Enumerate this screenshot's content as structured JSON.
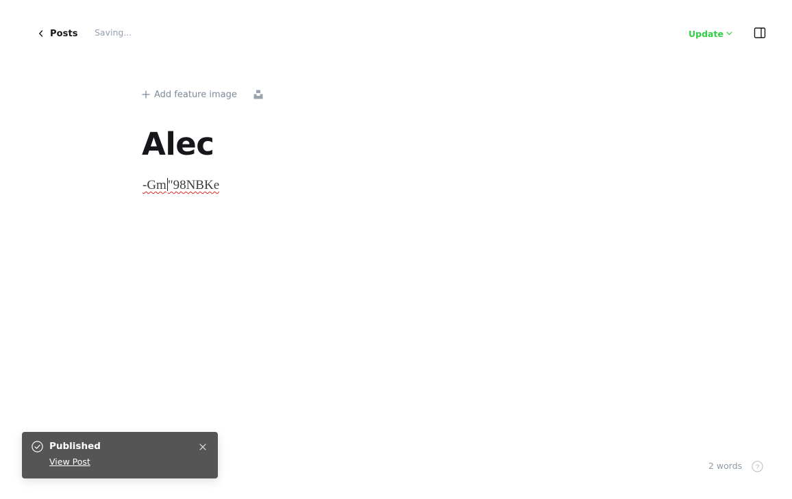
{
  "header": {
    "back_label": "Posts",
    "save_status": "Saving...",
    "update_label": "Update"
  },
  "editor": {
    "add_feature_label": "Add feature image",
    "title": "Alec",
    "body_before_caret": "-Gm",
    "body_after_caret": "\"98NBKe"
  },
  "toast": {
    "title": "Published",
    "link_label": "View Post"
  },
  "footer": {
    "word_count": "2 words",
    "help_label": "?"
  },
  "colors": {
    "accent_green": "#30cf43",
    "muted_text": "#95a1ad",
    "toast_bg": "#555556"
  },
  "icons": {
    "back": "chevron-left-icon",
    "update_dropdown": "chevron-down-icon",
    "sidebar": "sidebar-panel-icon",
    "add_feature": "plus-icon",
    "unsplash": "unsplash-icon",
    "toast_status": "check-circle-icon",
    "toast_close": "close-icon",
    "help": "question-circle-icon"
  }
}
